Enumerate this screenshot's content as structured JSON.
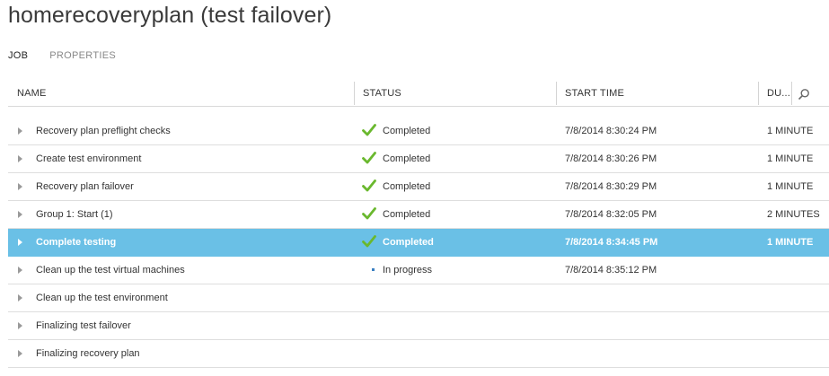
{
  "page": {
    "title": "homerecoveryplan (test failover)"
  },
  "tabs": [
    {
      "label": "JOB",
      "active": true
    },
    {
      "label": "PROPERTIES",
      "active": false
    }
  ],
  "table": {
    "columns": {
      "name": "NAME",
      "status": "STATUS",
      "start_time": "START TIME",
      "duration": "DU..."
    },
    "rows": [
      {
        "name": "Recovery plan preflight checks",
        "status": "Completed",
        "status_icon": "check-icon",
        "start_time": "7/8/2014 8:30:24 PM",
        "duration": "1 MINUTE",
        "selected": false
      },
      {
        "name": "Create test environment",
        "status": "Completed",
        "status_icon": "check-icon",
        "start_time": "7/8/2014 8:30:26 PM",
        "duration": "1 MINUTE",
        "selected": false
      },
      {
        "name": "Recovery plan failover",
        "status": "Completed",
        "status_icon": "check-icon",
        "start_time": "7/8/2014 8:30:29 PM",
        "duration": "1 MINUTE",
        "selected": false
      },
      {
        "name": "Group 1: Start (1)",
        "status": "Completed",
        "status_icon": "check-icon",
        "start_time": "7/8/2014 8:32:05 PM",
        "duration": "2 MINUTES",
        "selected": false
      },
      {
        "name": "Complete testing",
        "status": "Completed",
        "status_icon": "check-icon",
        "start_time": "7/8/2014 8:34:45 PM",
        "duration": "1 MINUTE",
        "selected": true
      },
      {
        "name": "Clean up the test virtual machines",
        "status": "In progress",
        "status_icon": "in-progress-icon",
        "start_time": "7/8/2014 8:35:12 PM",
        "duration": "",
        "selected": false
      },
      {
        "name": "Clean up the test environment",
        "status": "",
        "status_icon": "",
        "start_time": "",
        "duration": "",
        "selected": false
      },
      {
        "name": "Finalizing test failover",
        "status": "",
        "status_icon": "",
        "start_time": "",
        "duration": "",
        "selected": false
      },
      {
        "name": "Finalizing recovery plan",
        "status": "",
        "status_icon": "",
        "start_time": "",
        "duration": "",
        "selected": false
      }
    ]
  },
  "colors": {
    "selected_row": "#6ac0e6",
    "success_check": "#6ab82e",
    "progress": "#3a7fc1"
  }
}
